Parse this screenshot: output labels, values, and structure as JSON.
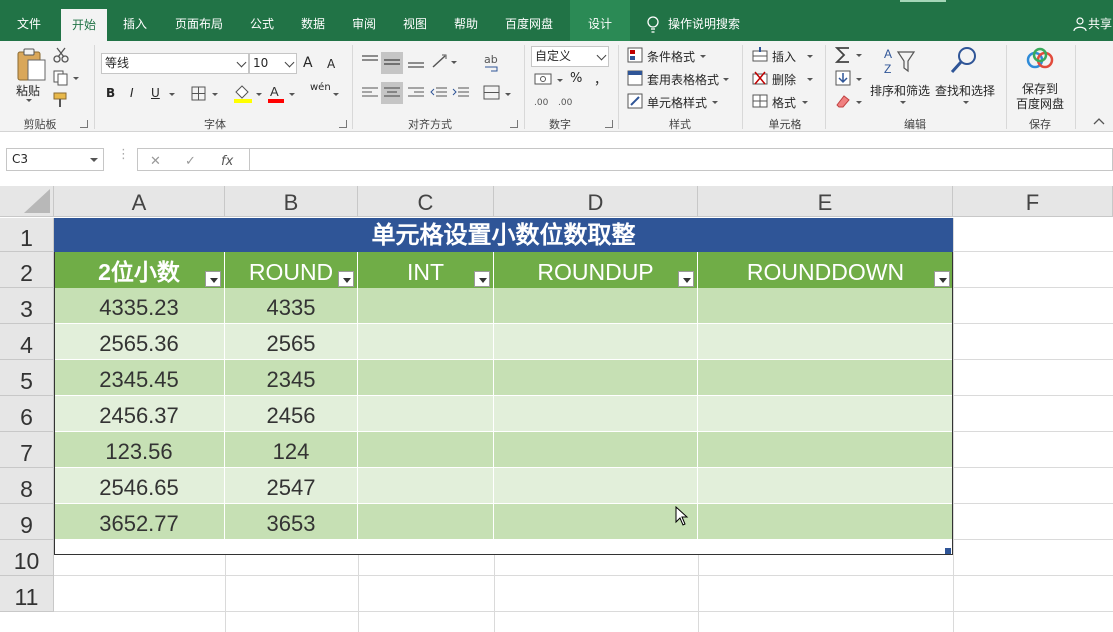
{
  "menu_tabs": [
    "文件",
    "开始",
    "插入",
    "页面布局",
    "公式",
    "数据",
    "审阅",
    "视图",
    "帮助",
    "百度网盘",
    "设计"
  ],
  "tell_me": "操作说明搜索",
  "share": "共享",
  "ribbon": {
    "clipboard": {
      "paste": "粘贴",
      "label": "剪贴板"
    },
    "font": {
      "name": "等线",
      "size": "10",
      "grow": "A",
      "shrink": "A",
      "bold": "B",
      "italic": "I",
      "underline": "U",
      "phonetic": "wén",
      "label": "字体"
    },
    "align": {
      "label": "对齐方式"
    },
    "number": {
      "format": "自定义",
      "percent": "%",
      "comma": "，",
      "label": "数字"
    },
    "styles": {
      "conditional": "条件格式",
      "table": "套用表格格式",
      "cell": "单元格样式",
      "label": "样式"
    },
    "cells": {
      "insert": "插入",
      "delete": "删除",
      "format": "格式",
      "label": "单元格"
    },
    "editing": {
      "sort": "排序和筛选",
      "find": "查找和选择",
      "label": "编辑"
    },
    "save": {
      "line1": "保存到",
      "line2": "百度网盘",
      "label": "保存"
    }
  },
  "formula_bar": {
    "name_box": "C3",
    "cancel": "✕",
    "enter": "✓",
    "fx": "fx",
    "value": ""
  },
  "columns": [
    "A",
    "B",
    "C",
    "D",
    "E",
    "F"
  ],
  "rows": [
    "1",
    "2",
    "3",
    "4",
    "5",
    "6",
    "7",
    "8",
    "9",
    "10",
    "11"
  ],
  "table": {
    "title": "单元格设置小数位数取整",
    "headers": [
      "2位小数",
      "ROUND",
      "INT",
      "ROUNDUP",
      "ROUNDDOWN"
    ],
    "data": [
      [
        "4335.23",
        "4335",
        "",
        "",
        ""
      ],
      [
        "2565.36",
        "2565",
        "",
        "",
        ""
      ],
      [
        "2345.45",
        "2345",
        "",
        "",
        ""
      ],
      [
        "2456.37",
        "2456",
        "",
        "",
        ""
      ],
      [
        "123.56",
        "124",
        "",
        "",
        ""
      ],
      [
        "2546.65",
        "2547",
        "",
        "",
        ""
      ],
      [
        "3652.77",
        "3653",
        "",
        "",
        ""
      ]
    ]
  },
  "colors": {
    "excel_green": "#217346",
    "title_blue": "#2f5597",
    "header_green": "#70ad47",
    "band_dark": "#c6e0b4",
    "band_light": "#e2efda"
  }
}
